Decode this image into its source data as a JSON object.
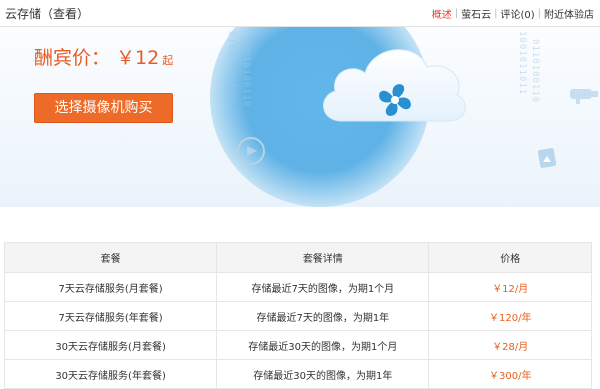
{
  "page": {
    "title": "云存储（查看）"
  },
  "topnav": {
    "items": [
      "概述",
      "萤石云",
      "评论(0)",
      "附近体验店"
    ],
    "active": "概述"
  },
  "banner": {
    "price_label": "酬宾价：",
    "price_value": "￥12",
    "price_suffix": "起",
    "button_label": "选择摄像机购买",
    "accent_color": "#ea5b23",
    "button_color": "#ee6a28"
  },
  "table": {
    "headers": [
      "套餐",
      "套餐详情",
      "价格"
    ],
    "rows": [
      [
        "7天云存储服务(月套餐)",
        "存储最近7天的图像，为期1个月",
        "￥12/月"
      ],
      [
        "7天云存储服务(年套餐)",
        "存储最近7天的图像，为期1年",
        "￥120/年"
      ],
      [
        "30天云存储服务(月套餐)",
        "存储最近30天的图像，为期1个月",
        "￥28/月"
      ],
      [
        "30天云存储服务(年套餐)",
        "存储最近30天的图像，为期1年",
        "￥300/年"
      ]
    ]
  },
  "icons": [
    "cloud-icon",
    "fan-icon",
    "play-icon",
    "camera-icon",
    "photo-icon"
  ]
}
